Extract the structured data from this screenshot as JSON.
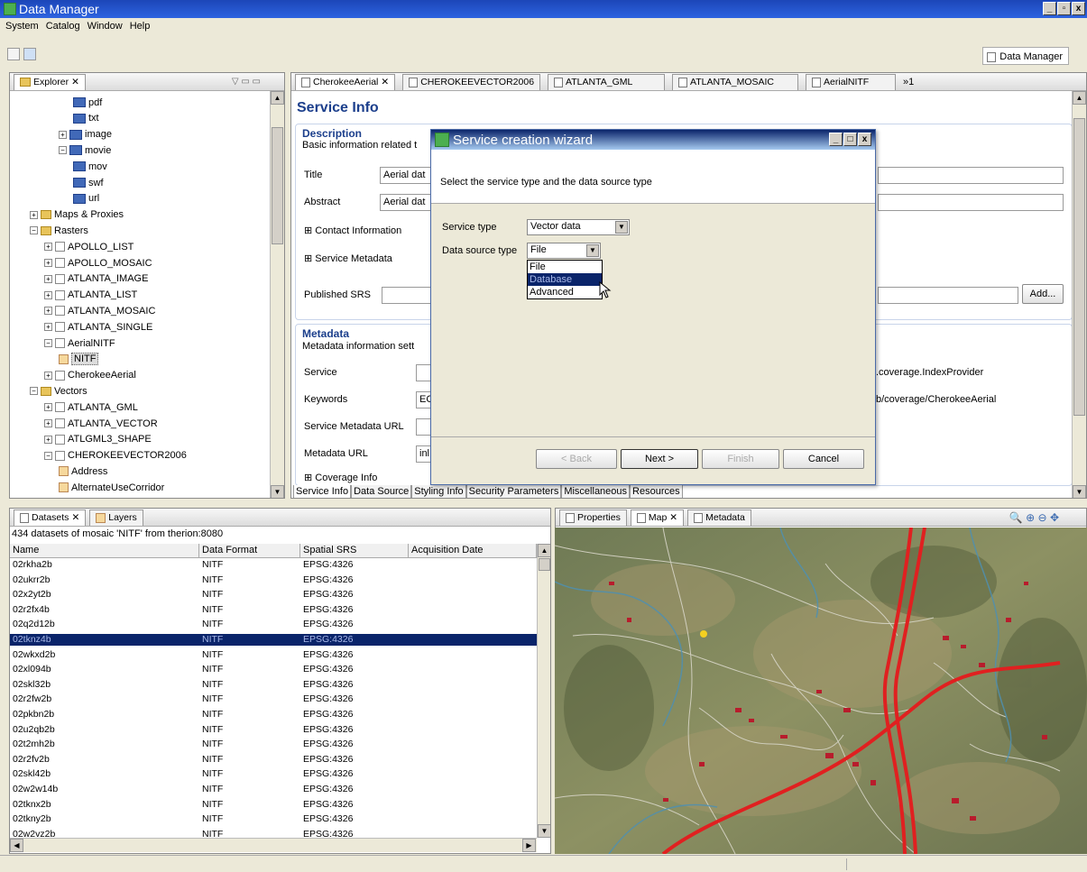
{
  "window": {
    "title": "Data Manager",
    "min": "_",
    "max": "▫",
    "close": "x"
  },
  "menu": [
    "System",
    "Catalog",
    "Window",
    "Help"
  ],
  "perspective": {
    "label": "Data Manager"
  },
  "explorer": {
    "tab": "Explorer",
    "tree": [
      {
        "label": "pdf",
        "indent": 4,
        "icon": "folder-blue"
      },
      {
        "label": "txt",
        "indent": 4,
        "icon": "folder-blue"
      },
      {
        "label": "image",
        "indent": 3,
        "icon": "folder-blue",
        "pm": "+"
      },
      {
        "label": "movie",
        "indent": 3,
        "icon": "folder-blue",
        "pm": "-"
      },
      {
        "label": "mov",
        "indent": 4,
        "icon": "folder-blue"
      },
      {
        "label": "swf",
        "indent": 4,
        "icon": "folder-blue"
      },
      {
        "label": "url",
        "indent": 4,
        "icon": "folder-blue"
      },
      {
        "label": "Maps & Proxies",
        "indent": 1,
        "icon": "folder",
        "pm": "+"
      },
      {
        "label": "Rasters",
        "indent": 1,
        "icon": "folder",
        "pm": "-"
      },
      {
        "label": "APOLLO_LIST",
        "indent": 2,
        "icon": "raster",
        "pm": "+"
      },
      {
        "label": "APOLLO_MOSAIC",
        "indent": 2,
        "icon": "raster",
        "pm": "+"
      },
      {
        "label": "ATLANTA_IMAGE",
        "indent": 2,
        "icon": "raster",
        "pm": "+"
      },
      {
        "label": "ATLANTA_LIST",
        "indent": 2,
        "icon": "raster",
        "pm": "+"
      },
      {
        "label": "ATLANTA_MOSAIC",
        "indent": 2,
        "icon": "raster",
        "pm": "+"
      },
      {
        "label": "ATLANTA_SINGLE",
        "indent": 2,
        "icon": "raster",
        "pm": "+"
      },
      {
        "label": "AerialNITF",
        "indent": 2,
        "icon": "raster",
        "pm": "-"
      },
      {
        "label": "NITF",
        "indent": 3,
        "icon": "vector",
        "selected": true
      },
      {
        "label": "CherokeeAerial",
        "indent": 2,
        "icon": "raster",
        "pm": "+"
      },
      {
        "label": "Vectors",
        "indent": 1,
        "icon": "folder",
        "pm": "-"
      },
      {
        "label": "ATLANTA_GML",
        "indent": 2,
        "icon": "raster",
        "pm": "+"
      },
      {
        "label": "ATLANTA_VECTOR",
        "indent": 2,
        "icon": "raster",
        "pm": "+"
      },
      {
        "label": "ATLGML3_SHAPE",
        "indent": 2,
        "icon": "raster",
        "pm": "+"
      },
      {
        "label": "CHEROKEEVECTOR2006",
        "indent": 2,
        "icon": "raster",
        "pm": "-"
      },
      {
        "label": "Address",
        "indent": 3,
        "icon": "vector"
      },
      {
        "label": "AlternateUseCorridor",
        "indent": 3,
        "icon": "vector"
      }
    ]
  },
  "editor": {
    "tabs": [
      "CherokeeAerial",
      "CHEROKEEVECTOR2006",
      "ATLANTA_GML",
      "ATLANTA_MOSAIC",
      "AerialNITF"
    ],
    "tab_overflow": "»1",
    "heading": "Service Info",
    "description": {
      "title": "Description",
      "subtitle": "Basic information related t"
    },
    "title_label": "Title",
    "title_value": "Aerial dat",
    "abstract_label": "Abstract",
    "abstract_value": "Aerial dat",
    "contact": "Contact Information",
    "service_metadata": "Service Metadata",
    "published_srs": "Published SRS",
    "add_button": "Add...",
    "metadata": {
      "title": "Metadata",
      "subtitle": "Metadata information sett"
    },
    "service_label": "Service",
    "service_value_right": ".coverage.IndexProvider",
    "keywords_label": "Keywords",
    "keywords_value": "EC",
    "keywords_value_right": "b/coverage/CherokeeAerial",
    "service_metadata_url": "Service Metadata URL",
    "metadata_url": "Metadata URL",
    "metadata_url_value": "inl",
    "coverage_info": "Coverage Info",
    "bottom_tabs": [
      "Service Info",
      "Data Source",
      "Styling Info",
      "Security Parameters",
      "Miscellaneous",
      "Resources"
    ]
  },
  "dialog": {
    "title": "Service creation wizard",
    "prompt": "Select the service type and the data source type",
    "service_type_label": "Service type",
    "service_type_value": "Vector data",
    "data_source_label": "Data source type",
    "data_source_value": "File",
    "options": [
      "File",
      "Database",
      "Advanced"
    ],
    "buttons": {
      "back": "< Back",
      "next": "Next >",
      "finish": "Finish",
      "cancel": "Cancel"
    }
  },
  "datasets": {
    "tabs": [
      "Datasets",
      "Layers"
    ],
    "summary": "434 datasets of mosaic 'NITF' from therion:8080",
    "columns": [
      "Name",
      "Data Format",
      "Spatial SRS",
      "Acquisition Date"
    ],
    "rows": [
      [
        "02rkha2b",
        "NITF",
        "EPSG:4326"
      ],
      [
        "02ukrr2b",
        "NITF",
        "EPSG:4326"
      ],
      [
        "02x2yt2b",
        "NITF",
        "EPSG:4326"
      ],
      [
        "02r2fx4b",
        "NITF",
        "EPSG:4326"
      ],
      [
        "02q2d12b",
        "NITF",
        "EPSG:4326"
      ],
      [
        "02tknz4b",
        "NITF",
        "EPSG:4326"
      ],
      [
        "02wkxd2b",
        "NITF",
        "EPSG:4326"
      ],
      [
        "02xl094b",
        "NITF",
        "EPSG:4326"
      ],
      [
        "02skl32b",
        "NITF",
        "EPSG:4326"
      ],
      [
        "02r2fw2b",
        "NITF",
        "EPSG:4326"
      ],
      [
        "02pkbn2b",
        "NITF",
        "EPSG:4326"
      ],
      [
        "02u2qb2b",
        "NITF",
        "EPSG:4326"
      ],
      [
        "02t2mh2b",
        "NITF",
        "EPSG:4326"
      ],
      [
        "02r2fv2b",
        "NITF",
        "EPSG:4326"
      ],
      [
        "02skl42b",
        "NITF",
        "EPSG:4326"
      ],
      [
        "02w2w14b",
        "NITF",
        "EPSG:4326"
      ],
      [
        "02tknx2b",
        "NITF",
        "EPSG:4326"
      ],
      [
        "02tkny2b",
        "NITF",
        "EPSG:4326"
      ],
      [
        "02w2vz2b",
        "NITF",
        "EPSG:4326"
      ]
    ],
    "selected_row": 5
  },
  "mappane": {
    "tabs": [
      "Properties",
      "Map",
      "Metadata"
    ]
  }
}
